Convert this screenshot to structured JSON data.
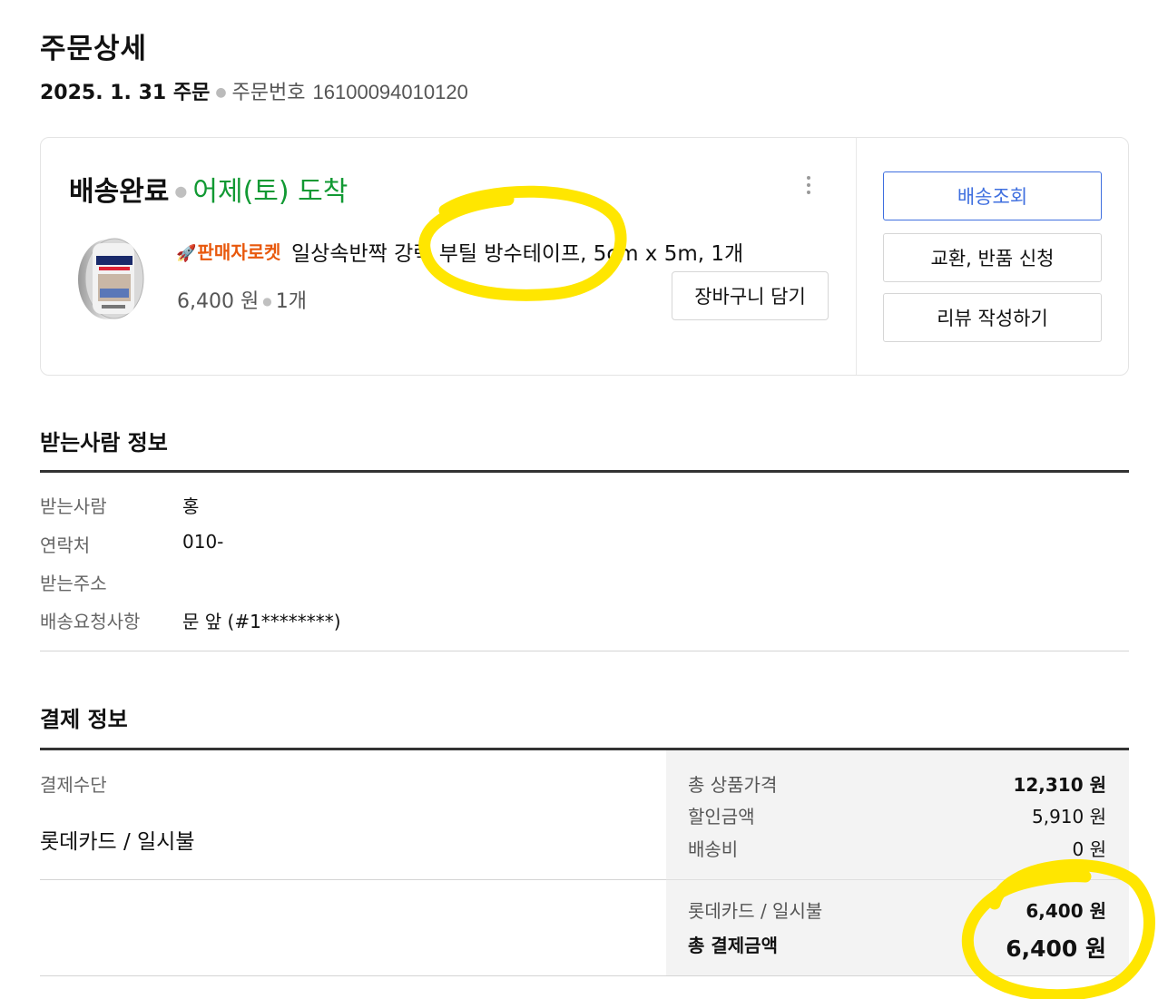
{
  "header": {
    "title": "주문상세",
    "order_date": "2025. 1. 31 주문",
    "order_number_label": "주문번호",
    "order_number": "16100094010120"
  },
  "order": {
    "status": "배송완료",
    "arrival": "어제(토) 도착",
    "badge": "판매자로켓",
    "product_name": "일상속반짝 강력 부틸 방수테이프, 5cm x 5m, 1개",
    "price": "6,400 원",
    "quantity": "1개",
    "cart_button": "장바구니 담기",
    "actions": {
      "track": "배송조회",
      "exchange_return": "교환, 반품 신청",
      "write_review": "리뷰 작성하기"
    }
  },
  "recipient": {
    "title": "받는사람 정보",
    "rows": [
      {
        "label": "받는사람",
        "value": "홍"
      },
      {
        "label": "연락처",
        "value": "010-"
      },
      {
        "label": "받는주소",
        "value": ""
      },
      {
        "label": "배송요청사항",
        "value": "문 앞 (#1********)"
      }
    ]
  },
  "payment": {
    "title": "결제 정보",
    "method_label": "결제수단",
    "method_value": "롯데카드 / 일시불",
    "summary": {
      "total_product_label": "총 상품가격",
      "total_product_value": "12,310 원",
      "discount_label": "할인금액",
      "discount_value": "5,910 원",
      "shipping_label": "배송비",
      "shipping_value": "0 원",
      "card_label": "롯데카드 / 일시불",
      "card_value": "6,400 원",
      "grand_total_label": "총 결제금액",
      "grand_total_value": "6,400 원"
    }
  },
  "colors": {
    "arrival_green": "#119933",
    "badge_orange": "#e8580c",
    "primary_blue": "#3f6fdf",
    "highlight_yellow": "#ffe600"
  }
}
